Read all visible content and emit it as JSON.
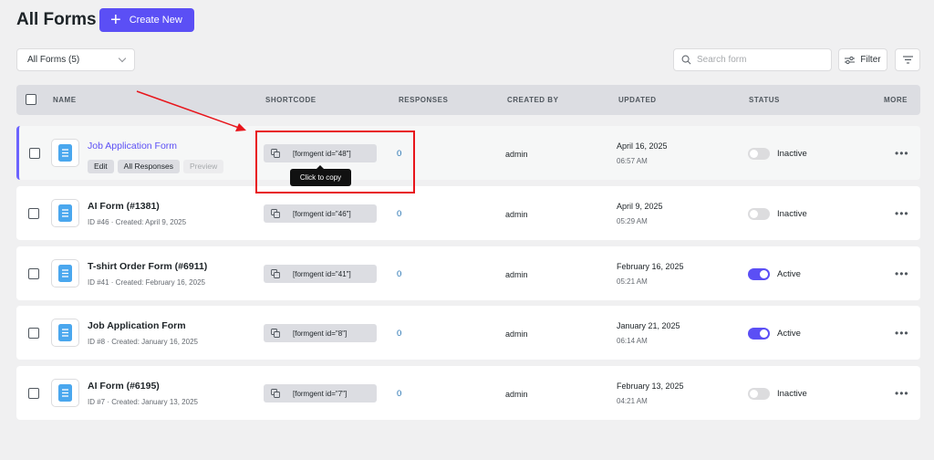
{
  "header": {
    "title": "All Forms",
    "create_label": "Create New"
  },
  "toolbar": {
    "filter_select": "All Forms (5)",
    "search_placeholder": "Search form",
    "filter_label": "Filter"
  },
  "columns": [
    "NAME",
    "SHORTCODE",
    "RESPONSES",
    "CREATED BY",
    "UPDATED",
    "STATUS",
    "MORE"
  ],
  "row_actions": {
    "edit": "Edit",
    "responses": "All Responses",
    "preview": "Preview"
  },
  "tooltip": "Click to copy",
  "rows": [
    {
      "title": "Job Application Form",
      "meta": "",
      "shortcode": "[formgent id=\"48\"]",
      "responses": "0",
      "author": "admin",
      "date": "April 16, 2025",
      "time": "06:57 AM",
      "status": "Inactive",
      "active": false
    },
    {
      "title": "AI Form (#1381)",
      "meta": "ID #46 · Created: April 9, 2025",
      "shortcode": "[formgent id=\"46\"]",
      "responses": "0",
      "author": "admin",
      "date": "April 9, 2025",
      "time": "05:29 AM",
      "status": "Inactive",
      "active": false
    },
    {
      "title": "T-shirt Order Form (#6911)",
      "meta": "ID #41 · Created: February 16, 2025",
      "shortcode": "[formgent id=\"41\"]",
      "responses": "0",
      "author": "admin",
      "date": "February 16, 2025",
      "time": "05:21 AM",
      "status": "Active",
      "active": true
    },
    {
      "title": "Job Application Form",
      "meta": "ID #8 · Created: January 16, 2025",
      "shortcode": "[formgent id=\"8\"]",
      "responses": "0",
      "author": "admin",
      "date": "January 21, 2025",
      "time": "06:14 AM",
      "status": "Active",
      "active": true
    },
    {
      "title": "AI Form (#6195)",
      "meta": "ID #7 · Created: January 13, 2025",
      "shortcode": "[formgent id=\"7\"]",
      "responses": "0",
      "author": "admin",
      "date": "February 13, 2025",
      "time": "04:21 AM",
      "status": "Inactive",
      "active": false
    }
  ],
  "colors": {
    "accent": "#5b4ff5",
    "annotation": "#e8151b",
    "link": "#2271b1"
  }
}
